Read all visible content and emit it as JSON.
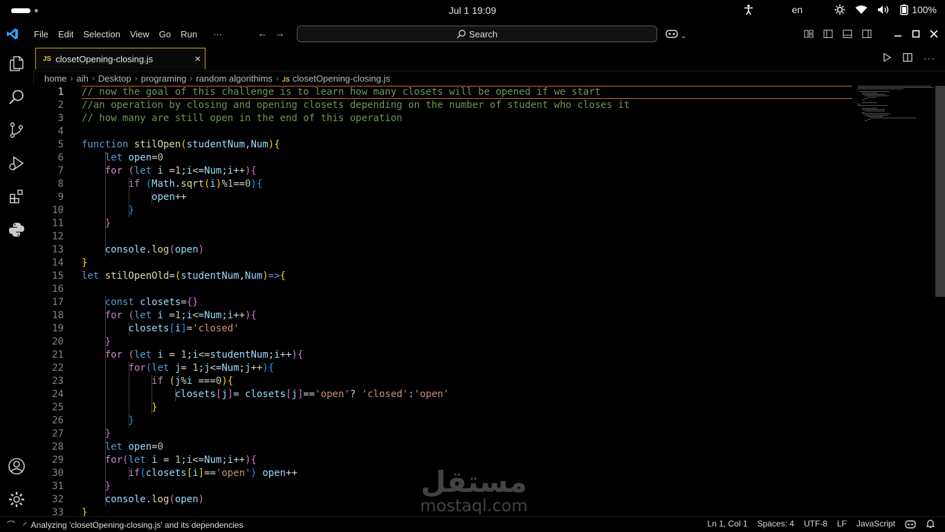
{
  "os_bar": {
    "clock": "Jul 1  19:09",
    "language": "en",
    "battery": "100%"
  },
  "menu": [
    "File",
    "Edit",
    "Selection",
    "View",
    "Go",
    "Run",
    "···"
  ],
  "search": {
    "label": "Search"
  },
  "tab": {
    "icon_label": "JS",
    "title": "closetOpening-closing.js"
  },
  "breadcrumb": {
    "items": [
      "home",
      "aih",
      "Desktop",
      "programing",
      "random algorithims"
    ],
    "file": "closetOpening-closing.js",
    "file_icon_label": "JS"
  },
  "editor": {
    "active_line": 1,
    "lines": [
      {
        "n": "1",
        "tokens": [
          [
            "c",
            "// now the goal of this challenge is to learn how many closets will be opened if we start"
          ]
        ]
      },
      {
        "n": "2",
        "tokens": [
          [
            "c",
            "//an operation by closing and opening closets depending on the number of student who closes it"
          ]
        ]
      },
      {
        "n": "3",
        "tokens": [
          [
            "c",
            "// how many are still open in the end of this operation"
          ]
        ]
      },
      {
        "n": "4",
        "tokens": []
      },
      {
        "n": "5",
        "tokens": [
          [
            "k",
            "function "
          ],
          [
            "f",
            "stilOpen"
          ],
          [
            "b1",
            "("
          ],
          [
            "v",
            "studentNum"
          ],
          [
            "p",
            ","
          ],
          [
            "v",
            "Num"
          ],
          [
            "b1",
            ")"
          ],
          [
            "b1",
            "{"
          ]
        ]
      },
      {
        "n": "6",
        "tokens": [
          [
            "p",
            "    "
          ],
          [
            "k",
            "let "
          ],
          [
            "v",
            "open"
          ],
          [
            "p",
            "="
          ],
          [
            "n",
            "0"
          ]
        ]
      },
      {
        "n": "7",
        "tokens": [
          [
            "p",
            "    "
          ],
          [
            "kc",
            "for "
          ],
          [
            "b2",
            "("
          ],
          [
            "k",
            "let "
          ],
          [
            "v",
            "i "
          ],
          [
            "p",
            "="
          ],
          [
            "n",
            "1"
          ],
          [
            "p",
            ";"
          ],
          [
            "v",
            "i"
          ],
          [
            "p",
            "<="
          ],
          [
            "v",
            "Num"
          ],
          [
            "p",
            ";"
          ],
          [
            "v",
            "i"
          ],
          [
            "p",
            "++"
          ],
          [
            "b2",
            ")"
          ],
          [
            "b2",
            "{"
          ]
        ]
      },
      {
        "n": "8",
        "tokens": [
          [
            "p",
            "        "
          ],
          [
            "kc",
            "if "
          ],
          [
            "b3",
            "("
          ],
          [
            "v",
            "Math"
          ],
          [
            "p",
            "."
          ],
          [
            "f",
            "sqrt"
          ],
          [
            "b1",
            "("
          ],
          [
            "v",
            "i"
          ],
          [
            "b1",
            ")"
          ],
          [
            "p",
            "%"
          ],
          [
            "n",
            "1"
          ],
          [
            "p",
            "=="
          ],
          [
            "n",
            "0"
          ],
          [
            "b3",
            ")"
          ],
          [
            "b3",
            "{"
          ]
        ]
      },
      {
        "n": "9",
        "tokens": [
          [
            "p",
            "            "
          ],
          [
            "v",
            "open"
          ],
          [
            "p",
            "++"
          ]
        ]
      },
      {
        "n": "10",
        "tokens": [
          [
            "p",
            "        "
          ],
          [
            "b3",
            "}"
          ]
        ]
      },
      {
        "n": "11",
        "tokens": [
          [
            "p",
            "    "
          ],
          [
            "b2",
            "}"
          ]
        ]
      },
      {
        "n": "12",
        "tokens": []
      },
      {
        "n": "13",
        "tokens": [
          [
            "p",
            "    "
          ],
          [
            "v",
            "console"
          ],
          [
            "p",
            "."
          ],
          [
            "f",
            "log"
          ],
          [
            "b2",
            "("
          ],
          [
            "v",
            "open"
          ],
          [
            "b2",
            ")"
          ]
        ]
      },
      {
        "n": "14",
        "tokens": [
          [
            "b1",
            "}"
          ]
        ]
      },
      {
        "n": "15",
        "tokens": [
          [
            "k",
            "let "
          ],
          [
            "f",
            "stilOpenOld"
          ],
          [
            "p",
            "="
          ],
          [
            "b1",
            "("
          ],
          [
            "v",
            "studentNum"
          ],
          [
            "p",
            ","
          ],
          [
            "v",
            "Num"
          ],
          [
            "b1",
            ")"
          ],
          [
            "k",
            "=>"
          ],
          [
            "b1",
            "{"
          ]
        ]
      },
      {
        "n": "16",
        "tokens": []
      },
      {
        "n": "17",
        "tokens": [
          [
            "p",
            "    "
          ],
          [
            "k",
            "const "
          ],
          [
            "v",
            "closets"
          ],
          [
            "p",
            "="
          ],
          [
            "b2",
            "{}"
          ]
        ]
      },
      {
        "n": "18",
        "tokens": [
          [
            "p",
            "    "
          ],
          [
            "kc",
            "for "
          ],
          [
            "b2",
            "("
          ],
          [
            "k",
            "let "
          ],
          [
            "v",
            "i "
          ],
          [
            "p",
            "="
          ],
          [
            "n",
            "1"
          ],
          [
            "p",
            ";"
          ],
          [
            "v",
            "i"
          ],
          [
            "p",
            "<="
          ],
          [
            "v",
            "Num"
          ],
          [
            "p",
            ";"
          ],
          [
            "v",
            "i"
          ],
          [
            "p",
            "++"
          ],
          [
            "b2",
            ")"
          ],
          [
            "b2",
            "{"
          ]
        ]
      },
      {
        "n": "19",
        "tokens": [
          [
            "p",
            "        "
          ],
          [
            "v",
            "closets"
          ],
          [
            "b3",
            "["
          ],
          [
            "v",
            "i"
          ],
          [
            "b3",
            "]"
          ],
          [
            "p",
            "="
          ],
          [
            "s",
            "'closed'"
          ]
        ]
      },
      {
        "n": "20",
        "tokens": [
          [
            "p",
            "    "
          ],
          [
            "b2",
            "}"
          ]
        ]
      },
      {
        "n": "21",
        "tokens": [
          [
            "p",
            "    "
          ],
          [
            "kc",
            "for "
          ],
          [
            "b2",
            "("
          ],
          [
            "k",
            "let "
          ],
          [
            "v",
            "i "
          ],
          [
            "p",
            "= "
          ],
          [
            "n",
            "1"
          ],
          [
            "p",
            ";"
          ],
          [
            "v",
            "i"
          ],
          [
            "p",
            "<="
          ],
          [
            "v",
            "studentNum"
          ],
          [
            "p",
            ";"
          ],
          [
            "v",
            "i"
          ],
          [
            "p",
            "++"
          ],
          [
            "b2",
            ")"
          ],
          [
            "b2",
            "{"
          ]
        ]
      },
      {
        "n": "22",
        "tokens": [
          [
            "p",
            "        "
          ],
          [
            "kc",
            "for"
          ],
          [
            "b3",
            "("
          ],
          [
            "k",
            "let "
          ],
          [
            "v",
            "j"
          ],
          [
            "p",
            "= "
          ],
          [
            "n",
            "1"
          ],
          [
            "p",
            ";"
          ],
          [
            "v",
            "j"
          ],
          [
            "p",
            "<="
          ],
          [
            "v",
            "Num"
          ],
          [
            "p",
            ";"
          ],
          [
            "v",
            "j"
          ],
          [
            "p",
            "++"
          ],
          [
            "b3",
            ")"
          ],
          [
            "b3",
            "{"
          ]
        ]
      },
      {
        "n": "23",
        "tokens": [
          [
            "p",
            "            "
          ],
          [
            "kc",
            "if "
          ],
          [
            "b1",
            "("
          ],
          [
            "v",
            "j"
          ],
          [
            "p",
            "%"
          ],
          [
            "v",
            "i "
          ],
          [
            "p",
            "==="
          ],
          [
            "n",
            "0"
          ],
          [
            "b1",
            ")"
          ],
          [
            "b1",
            "{"
          ]
        ]
      },
      {
        "n": "24",
        "tokens": [
          [
            "p",
            "                "
          ],
          [
            "v",
            "closets"
          ],
          [
            "b2",
            "["
          ],
          [
            "v",
            "j"
          ],
          [
            "b2",
            "]"
          ],
          [
            "p",
            "= "
          ],
          [
            "v",
            "closets"
          ],
          [
            "b2",
            "["
          ],
          [
            "v",
            "j"
          ],
          [
            "b2",
            "]"
          ],
          [
            "p",
            "=="
          ],
          [
            "s",
            "'open'"
          ],
          [
            "p",
            "? "
          ],
          [
            "s",
            "'closed'"
          ],
          [
            "p",
            ":"
          ],
          [
            "s",
            "'open'"
          ]
        ]
      },
      {
        "n": "25",
        "tokens": [
          [
            "p",
            "            "
          ],
          [
            "b1",
            "}"
          ]
        ]
      },
      {
        "n": "26",
        "tokens": [
          [
            "p",
            "        "
          ],
          [
            "b3",
            "}"
          ]
        ]
      },
      {
        "n": "27",
        "tokens": [
          [
            "p",
            "    "
          ],
          [
            "b2",
            "}"
          ]
        ]
      },
      {
        "n": "28",
        "tokens": [
          [
            "p",
            "    "
          ],
          [
            "k",
            "let "
          ],
          [
            "v",
            "open"
          ],
          [
            "p",
            "="
          ],
          [
            "n",
            "0"
          ]
        ]
      },
      {
        "n": "29",
        "tokens": [
          [
            "p",
            "    "
          ],
          [
            "kc",
            "for"
          ],
          [
            "b2",
            "("
          ],
          [
            "k",
            "let "
          ],
          [
            "v",
            "i "
          ],
          [
            "p",
            "= "
          ],
          [
            "n",
            "1"
          ],
          [
            "p",
            ";"
          ],
          [
            "v",
            "i"
          ],
          [
            "p",
            "<="
          ],
          [
            "v",
            "Num"
          ],
          [
            "p",
            ";"
          ],
          [
            "v",
            "i"
          ],
          [
            "p",
            "++"
          ],
          [
            "b2",
            ")"
          ],
          [
            "b2",
            "{"
          ]
        ]
      },
      {
        "n": "30",
        "tokens": [
          [
            "p",
            "        "
          ],
          [
            "kc",
            "if"
          ],
          [
            "b3",
            "("
          ],
          [
            "v",
            "closets"
          ],
          [
            "b1",
            "["
          ],
          [
            "v",
            "i"
          ],
          [
            "b1",
            "]"
          ],
          [
            "p",
            "=="
          ],
          [
            "s",
            "'open'"
          ],
          [
            "b3",
            ") "
          ],
          [
            "v",
            "open"
          ],
          [
            "p",
            "++"
          ]
        ]
      },
      {
        "n": "31",
        "tokens": [
          [
            "p",
            "    "
          ],
          [
            "b2",
            "}"
          ]
        ]
      },
      {
        "n": "32",
        "tokens": [
          [
            "p",
            "    "
          ],
          [
            "v",
            "console"
          ],
          [
            "p",
            "."
          ],
          [
            "f",
            "log"
          ],
          [
            "b2",
            "("
          ],
          [
            "v",
            "open"
          ],
          [
            "b2",
            ")"
          ]
        ]
      },
      {
        "n": "33",
        "tokens": [
          [
            "b1",
            "}"
          ]
        ]
      }
    ]
  },
  "watermark": {
    "arabic": "مستقل",
    "latin": "mostaql.com"
  },
  "status": {
    "analyzing": "Analyzing 'closetOpening-closing.js' and its dependencies",
    "position": "Ln 1, Col 1",
    "spaces": "Spaces: 4",
    "encoding": "UTF-8",
    "eol": "LF",
    "language": "JavaScript"
  },
  "icons": {
    "activity": [
      "explorer-icon",
      "search-icon",
      "source-control-icon",
      "run-debug-icon",
      "extensions-icon",
      "python-icon",
      "account-icon",
      "settings-gear-icon"
    ]
  }
}
